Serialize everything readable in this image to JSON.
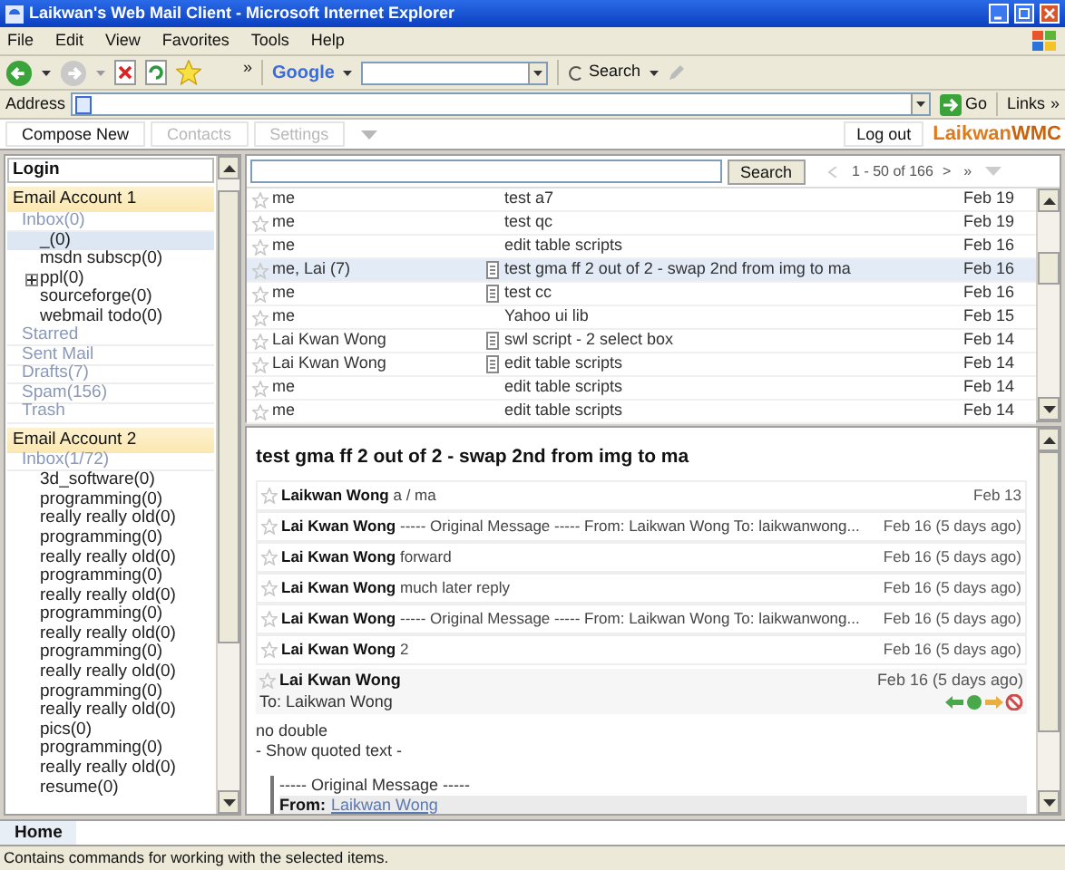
{
  "window": {
    "title": "Laikwan's Web Mail Client - Microsoft Internet Explorer"
  },
  "menu": [
    "File",
    "Edit",
    "View",
    "Favorites",
    "Tools",
    "Help"
  ],
  "toolbar": {
    "more": "»",
    "search_logo": "Google",
    "search_button": "Search"
  },
  "address_bar": {
    "label": "Address",
    "go": "Go",
    "links": "Links",
    "more": "»"
  },
  "app_nav": {
    "buttons": [
      {
        "label": "Compose New",
        "disabled": false
      },
      {
        "label": "Contacts",
        "disabled": true
      },
      {
        "label": "Settings",
        "disabled": true
      }
    ],
    "logout": "Log out",
    "logo": [
      "Laikwan",
      "WMC"
    ]
  },
  "sidebar": {
    "header": "Login",
    "accounts": [
      {
        "title": "Email Account 1",
        "folders": [
          {
            "label": "Inbox(0)",
            "selected": false,
            "children": [
              {
                "label": "_(0)",
                "selected": true
              },
              {
                "label": "msdn subscp(0)",
                "selected": false
              },
              {
                "label": "ppl(0)",
                "selected": false,
                "expanded": false
              },
              {
                "label": "sourceforge(0)",
                "selected": false
              },
              {
                "label": "webmail todo(0)",
                "selected": false
              }
            ]
          },
          {
            "label": "Starred",
            "selected": false
          },
          {
            "label": "Sent Mail",
            "selected": false
          },
          {
            "label": "Drafts(7)",
            "selected": false
          },
          {
            "label": "Spam(156)",
            "selected": false
          },
          {
            "label": "Trash",
            "selected": false
          }
        ]
      },
      {
        "title": "Email Account 2",
        "folders": [
          {
            "label": "Inbox(1/72)",
            "selected": false,
            "children": [
              {
                "label": "3d_software(0)",
                "selected": false
              },
              {
                "label": "programming(0)",
                "selected": false
              },
              {
                "label": "really really old(0)",
                "selected": false
              },
              {
                "label": "programming(0)",
                "selected": false
              },
              {
                "label": "really really old(0)",
                "selected": false
              },
              {
                "label": "programming(0)",
                "selected": false
              },
              {
                "label": "really really old(0)",
                "selected": false
              },
              {
                "label": "programming(0)",
                "selected": false
              },
              {
                "label": "really really old(0)",
                "selected": false
              },
              {
                "label": "programming(0)",
                "selected": false
              },
              {
                "label": "really really old(0)",
                "selected": false
              },
              {
                "label": "programming(0)",
                "selected": false
              },
              {
                "label": "really really old(0)",
                "selected": false
              },
              {
                "label": "pics(0)",
                "selected": false
              },
              {
                "label": "programming(0)",
                "selected": false
              },
              {
                "label": "really really old(0)",
                "selected": false
              },
              {
                "label": "resume(0)",
                "selected": false
              }
            ]
          }
        ]
      }
    ]
  },
  "mail_list": {
    "search_button": "Search",
    "pager": "1 - 50 of 166",
    "next": ">",
    "last": "»",
    "rows": [
      {
        "sender": "me",
        "attachment": false,
        "subject": "test a7",
        "date": "Feb 19",
        "selected": false
      },
      {
        "sender": "me",
        "attachment": false,
        "subject": "test qc",
        "date": "Feb 19",
        "selected": false
      },
      {
        "sender": "me",
        "attachment": false,
        "subject": "edit table scripts",
        "date": "Feb 16",
        "selected": false
      },
      {
        "sender": "me, Lai (7)",
        "attachment": true,
        "subject": "test gma ff 2 out of 2 - swap 2nd from img to ma",
        "date": "Feb 16",
        "selected": true
      },
      {
        "sender": "me",
        "attachment": true,
        "subject": "test cc",
        "date": "Feb 16",
        "selected": false
      },
      {
        "sender": "me",
        "attachment": false,
        "subject": "Yahoo ui lib",
        "date": "Feb 15",
        "selected": false
      },
      {
        "sender": "Lai Kwan Wong",
        "attachment": true,
        "subject": "swl script - 2 select box",
        "date": "Feb 14",
        "selected": false
      },
      {
        "sender": "Lai Kwan Wong",
        "attachment": true,
        "subject": "edit table scripts",
        "date": "Feb 14",
        "selected": false
      },
      {
        "sender": "me",
        "attachment": false,
        "subject": "edit table scripts",
        "date": "Feb 14",
        "selected": false
      },
      {
        "sender": "me",
        "attachment": false,
        "subject": "edit table scripts",
        "date": "Feb 14",
        "selected": false
      }
    ]
  },
  "reader": {
    "title": "test gma ff 2 out of 2 - swap 2nd from img to ma",
    "thread": [
      {
        "sender": "Laikwan Wong",
        "snippet": "a / ma",
        "date": "Feb 13"
      },
      {
        "sender": "Lai Kwan Wong",
        "snippet": "----- Original Message ----- From: Laikwan Wong To: laikwanwong...",
        "date": "Feb 16 (5 days ago)"
      },
      {
        "sender": "Lai Kwan Wong",
        "snippet": "forward",
        "date": "Feb 16 (5 days ago)"
      },
      {
        "sender": "Lai Kwan Wong",
        "snippet": "much later reply",
        "date": "Feb 16 (5 days ago)"
      },
      {
        "sender": "Lai Kwan Wong",
        "snippet": "----- Original Message ----- From: Laikwan Wong To: laikwanwong...",
        "date": "Feb 16 (5 days ago)"
      },
      {
        "sender": "Lai Kwan Wong",
        "snippet": "2",
        "date": "Feb 16 (5 days ago)"
      }
    ],
    "open": {
      "sender": "Lai Kwan Wong",
      "date": "Feb 16 (5 days ago)",
      "to": "To: Laikwan Wong",
      "body": "no double",
      "quoted_toggle": "- Show quoted text -",
      "quote_header": "----- Original Message -----",
      "from_label": "From:",
      "from_link": "Laikwan Wong"
    }
  },
  "bottom_tab": "Home",
  "status_bar": "Contains commands for working with the selected items."
}
